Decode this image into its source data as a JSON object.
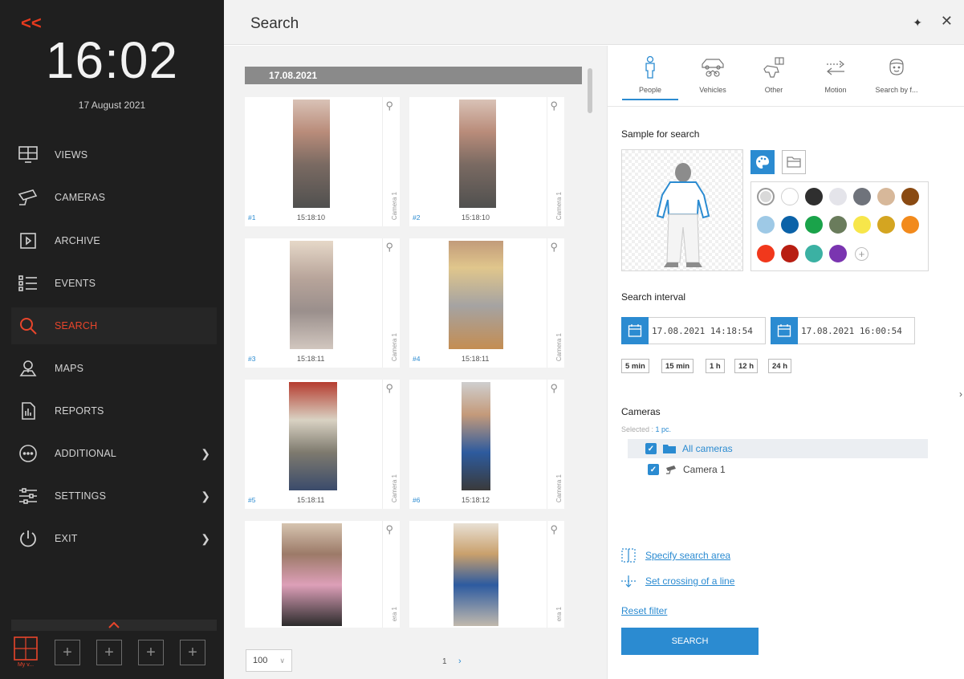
{
  "sidebar": {
    "collapse_glyph": "<<",
    "clock": "16:02",
    "date": "17 August 2021",
    "items": [
      {
        "label": "VIEWS",
        "icon": "views-icon",
        "chevron": false,
        "active": false
      },
      {
        "label": "CAMERAS",
        "icon": "camera-icon",
        "chevron": false,
        "active": false
      },
      {
        "label": "ARCHIVE",
        "icon": "archive-icon",
        "chevron": false,
        "active": false
      },
      {
        "label": "EVENTS",
        "icon": "events-icon",
        "chevron": false,
        "active": false
      },
      {
        "label": "SEARCH",
        "icon": "search-icon",
        "chevron": false,
        "active": true
      },
      {
        "label": "MAPS",
        "icon": "maps-icon",
        "chevron": false,
        "active": false
      },
      {
        "label": "REPORTS",
        "icon": "reports-icon",
        "chevron": false,
        "active": false
      },
      {
        "label": "ADDITIONAL",
        "icon": "additional-icon",
        "chevron": true,
        "active": false
      },
      {
        "label": "SETTINGS",
        "icon": "settings-icon",
        "chevron": true,
        "active": false
      },
      {
        "label": "EXIT",
        "icon": "power-icon",
        "chevron": true,
        "active": false
      }
    ],
    "myview_label": "My v...",
    "accent": "#e8452b"
  },
  "header": {
    "title": "Search",
    "pin_glyph": "✦",
    "close_glyph": "✕"
  },
  "results": {
    "date_header": "17.08.2021",
    "cards": [
      {
        "num": "#1",
        "time": "15:18:10",
        "camera": "Camera 1"
      },
      {
        "num": "#2",
        "time": "15:18:10",
        "camera": "Camera 1"
      },
      {
        "num": "#3",
        "time": "15:18:11",
        "camera": "Camera 1"
      },
      {
        "num": "#4",
        "time": "15:18:11",
        "camera": "Camera 1"
      },
      {
        "num": "#5",
        "time": "15:18:11",
        "camera": "Camera 1"
      },
      {
        "num": "#6",
        "time": "15:18:12",
        "camera": "Camera 1"
      },
      {
        "num": "",
        "time": "",
        "camera": "era 1"
      },
      {
        "num": "",
        "time": "",
        "camera": "era 1"
      }
    ],
    "page_size": "100",
    "page_size_chevron": "∨",
    "page_number": "1",
    "next_glyph": "›"
  },
  "filter": {
    "tabs": [
      {
        "label": "People",
        "icon": "person-icon",
        "active": true
      },
      {
        "label": "Vehicles",
        "icon": "vehicle-icon",
        "active": false
      },
      {
        "label": "Other",
        "icon": "other-objects-icon",
        "active": false
      },
      {
        "label": "Motion",
        "icon": "motion-arrows-icon",
        "active": false
      },
      {
        "label": "Search by f...",
        "icon": "face-icon",
        "active": false
      }
    ],
    "sample_title": "Sample for search",
    "colors": [
      "#d9d9d9",
      "#ffffff",
      "#2f2f2f",
      "#e4e4ea",
      "#6f737b",
      "#d7b89a",
      "#8a4a12",
      "#9ec9e6",
      "#0b62a8",
      "#1aa34a",
      "#6a7c5c",
      "#f7e64a",
      "#d4a521",
      "#f28a1c",
      "#f1381c",
      "#b81e12",
      "#3bb1a3",
      "#7a35b0"
    ],
    "add_color_glyph": "+",
    "interval_title": "Search interval",
    "date_from": "17.08.2021  14:18:54",
    "date_to": "17.08.2021  16:00:54",
    "quick_ranges": [
      "5 min",
      "15 min",
      "1 h",
      "12 h",
      "24 h"
    ],
    "cameras_title": "Cameras",
    "selected_prefix": "Selected : ",
    "selected_value": "1 pc.",
    "all_cameras": "All cameras",
    "camera_1": "Camera 1",
    "check_glyph": "✓",
    "specify_area": "Specify search area",
    "crossing_line": "Set crossing of a line",
    "reset": "Reset filter",
    "search_button": "SEARCH",
    "side_chevron": "›",
    "accent": "#2b8bd1"
  }
}
